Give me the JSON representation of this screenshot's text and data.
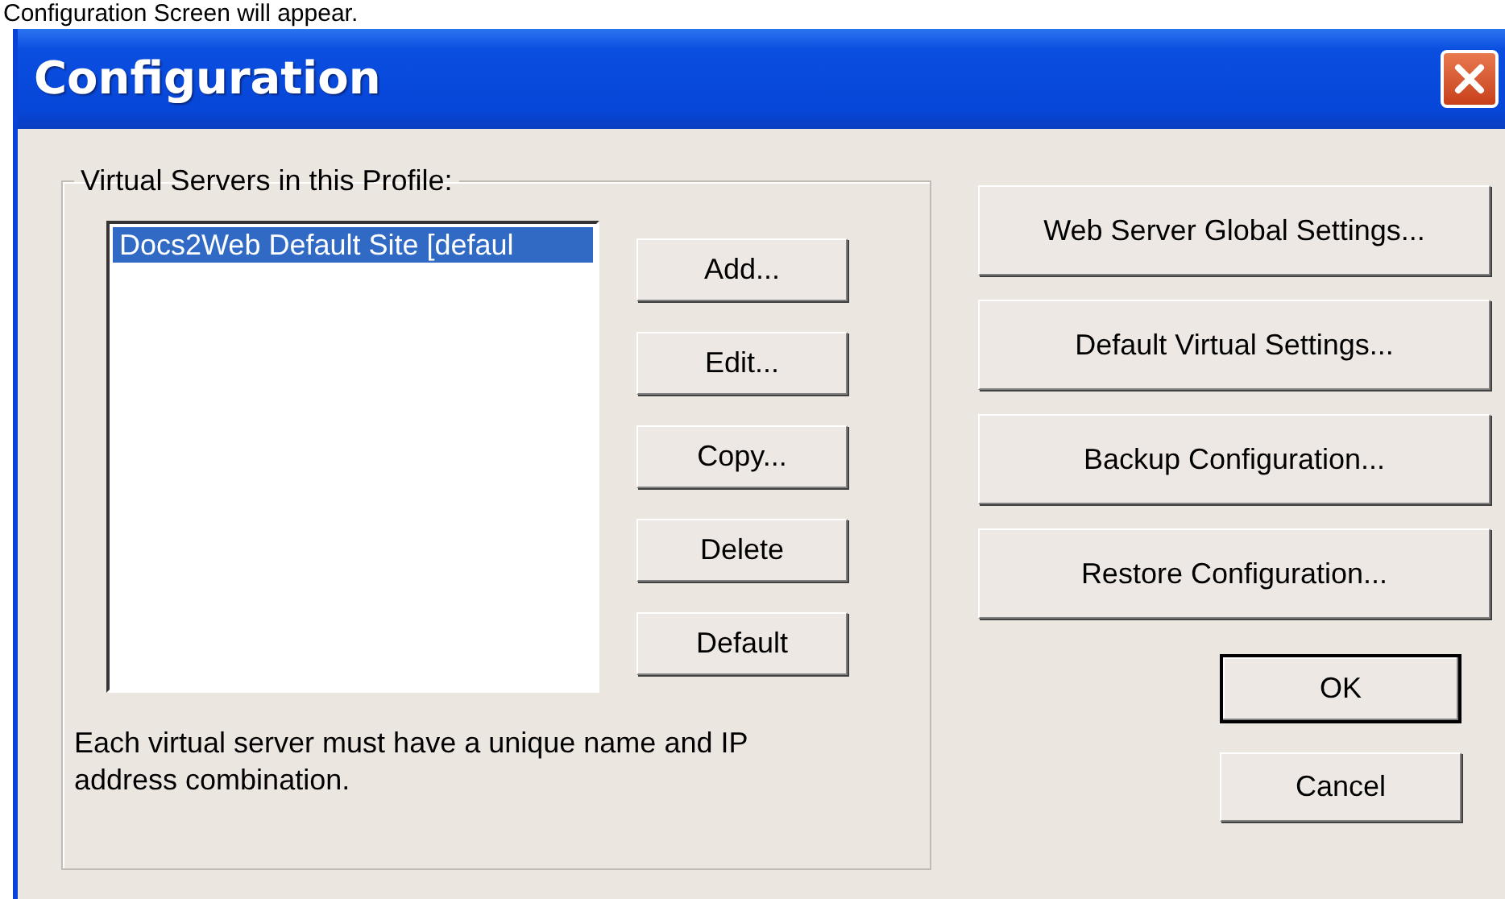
{
  "caption": "Configuration Screen will appear.",
  "window": {
    "title": "Configuration"
  },
  "group": {
    "label": "Virtual Servers in this Profile:",
    "servers": [
      {
        "name": "Docs2Web Default Site [defaul",
        "selected": true
      }
    ],
    "buttons": [
      "Add...",
      "Edit...",
      "Copy...",
      "Delete",
      "Default"
    ],
    "note": "Each virtual server must have a unique name and IP address combination."
  },
  "side_buttons": [
    "Web Server Global Settings...",
    "Default Virtual Settings...",
    "Backup Configuration...",
    "Restore Configuration..."
  ],
  "dialog_buttons": [
    {
      "label": "OK",
      "default": true
    },
    {
      "label": "Cancel",
      "default": false
    }
  ]
}
